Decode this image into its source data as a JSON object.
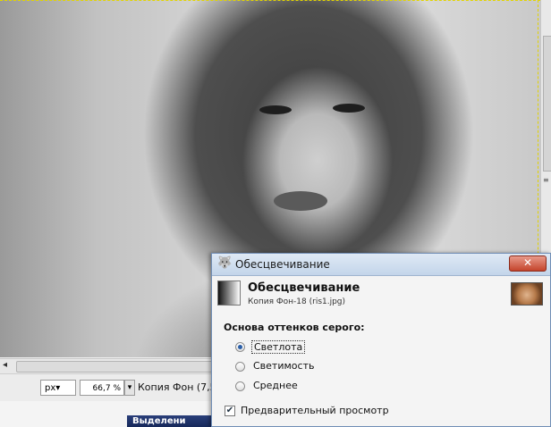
{
  "canvas": {
    "image_alt_icon": "grayscale-photo"
  },
  "statusbar": {
    "unit": "px",
    "unit_arrow": "▾",
    "zoom": "66,7 %",
    "zoom_arrow": "▾",
    "layer_info": "Копия Фон (7,5"
  },
  "taskbar": {
    "item_label": "Выделени"
  },
  "dialog": {
    "window_title": "Обесцвечивание",
    "close_glyph": "✕",
    "heading": "Обесцвечивание",
    "subtitle": "Копия Фон-18 (ris1.jpg)",
    "section_label": "Основа оттенков серого:",
    "options": [
      {
        "label": "Светлота",
        "selected": true
      },
      {
        "label": "Светимость",
        "selected": false
      },
      {
        "label": "Среднее",
        "selected": false
      }
    ],
    "preview_label": "Предварительный просмотр",
    "preview_checked": true,
    "check_glyph": "✔"
  },
  "colors": {
    "selection_dash": "#e2d400",
    "close_button": "#c4442c",
    "titlebar": "#c3d5ea"
  }
}
